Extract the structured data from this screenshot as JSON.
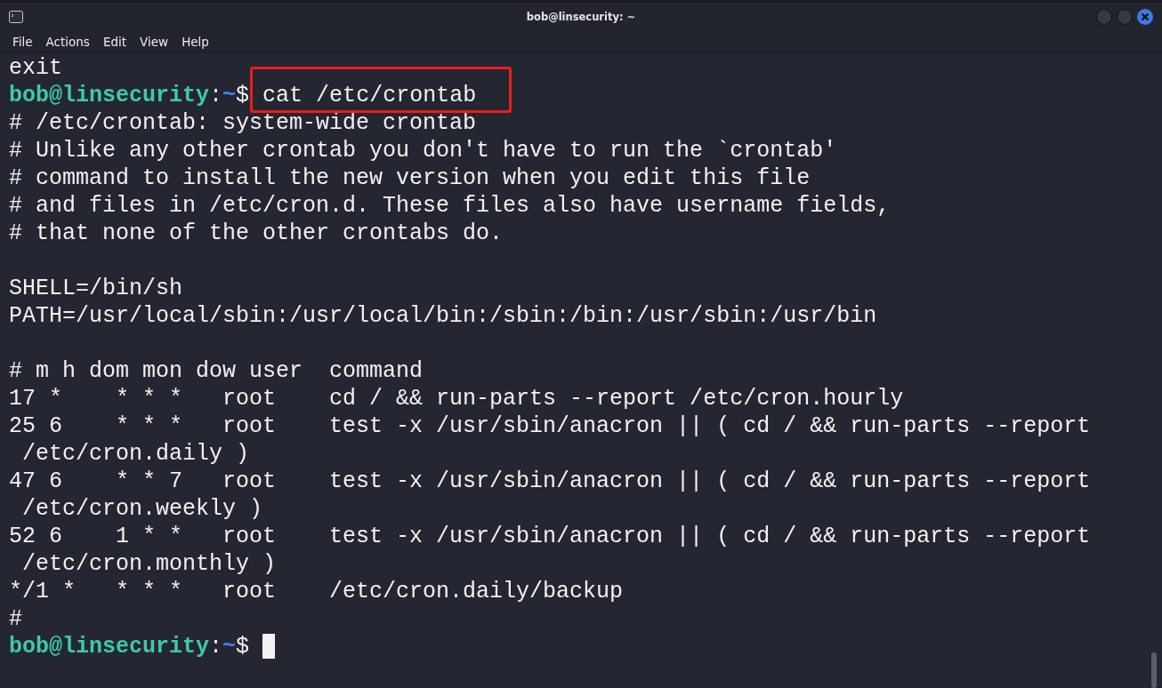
{
  "window": {
    "title": "bob@linsecurity: ~"
  },
  "menu": [
    "File",
    "Actions",
    "Edit",
    "View",
    "Help"
  ],
  "terminal": {
    "lines": [
      {
        "kind": "output",
        "text": "exit"
      },
      {
        "kind": "prompt",
        "user_host": "bob@linsecurity",
        "separator": ":",
        "path": "~",
        "symbol": "$",
        "command": "cat /etc/crontab",
        "highlighted": true,
        "cursor": false
      },
      {
        "kind": "output",
        "text": "# /etc/crontab: system-wide crontab"
      },
      {
        "kind": "output",
        "text": "# Unlike any other crontab you don't have to run the `crontab'"
      },
      {
        "kind": "output",
        "text": "# command to install the new version when you edit this file"
      },
      {
        "kind": "output",
        "text": "# and files in /etc/cron.d. These files also have username fields,"
      },
      {
        "kind": "output",
        "text": "# that none of the other crontabs do."
      },
      {
        "kind": "blank"
      },
      {
        "kind": "output",
        "text": "SHELL=/bin/sh"
      },
      {
        "kind": "output",
        "text": "PATH=/usr/local/sbin:/usr/local/bin:/sbin:/bin:/usr/sbin:/usr/bin"
      },
      {
        "kind": "blank"
      },
      {
        "kind": "output",
        "text": "# m h dom mon dow user  command"
      },
      {
        "kind": "output",
        "text": "17 *    * * *   root    cd / && run-parts --report /etc/cron.hourly"
      },
      {
        "kind": "output",
        "text": "25 6    * * *   root    test -x /usr/sbin/anacron || ( cd / && run-parts --report"
      },
      {
        "kind": "output",
        "text": " /etc/cron.daily )"
      },
      {
        "kind": "output",
        "text": "47 6    * * 7   root    test -x /usr/sbin/anacron || ( cd / && run-parts --report"
      },
      {
        "kind": "output",
        "text": " /etc/cron.weekly )"
      },
      {
        "kind": "output",
        "text": "52 6    1 * *   root    test -x /usr/sbin/anacron || ( cd / && run-parts --report"
      },
      {
        "kind": "output",
        "text": " /etc/cron.monthly )"
      },
      {
        "kind": "output",
        "text": "*/1 *   * * *   root    /etc/cron.daily/backup"
      },
      {
        "kind": "output",
        "text": "#"
      },
      {
        "kind": "prompt",
        "user_host": "bob@linsecurity",
        "separator": ":",
        "path": "~",
        "symbol": "$",
        "cursor": true
      }
    ]
  }
}
